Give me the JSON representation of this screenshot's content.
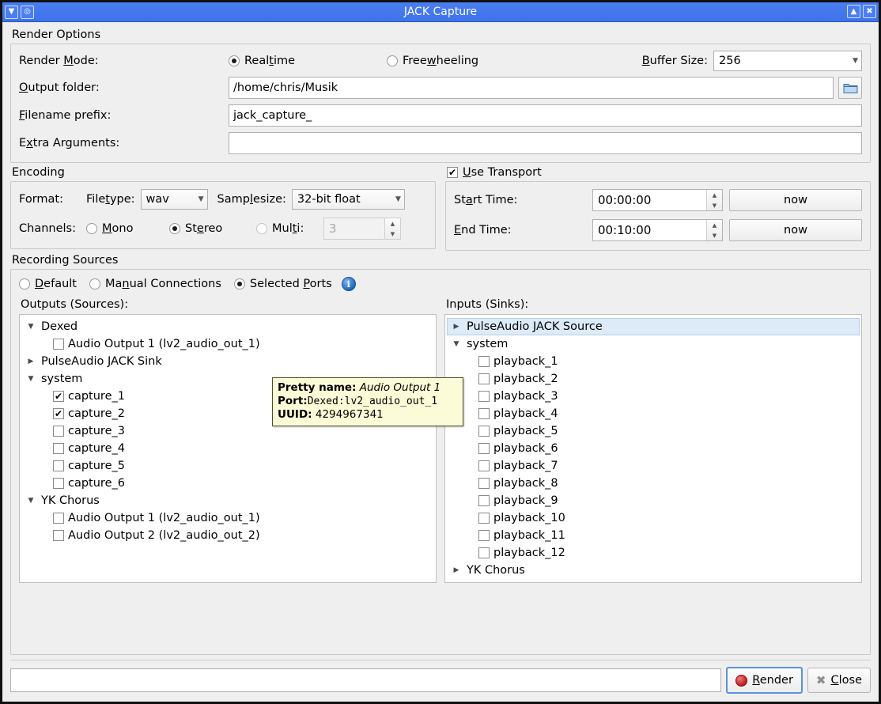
{
  "window": {
    "title": "JACK Capture",
    "titlebar_buttons_left": [
      "menu-chevron",
      "shade-circle"
    ],
    "titlebar_buttons_right": [
      "maximize-up",
      "close-x"
    ]
  },
  "render_options": {
    "group_title": "Render Options",
    "render_mode_label": "Render Mode:",
    "modes": [
      {
        "label": "Realtime",
        "mnemonic": "t",
        "selected": true
      },
      {
        "label": "Freewheeling",
        "mnemonic": "w",
        "selected": false
      }
    ],
    "buffer_size_label": "Buffer Size:",
    "buffer_size_value": "256",
    "output_folder_label": "Output folder:",
    "output_folder_value": "/home/chris/Musik",
    "browse_icon": "folder-icon",
    "filename_prefix_label": "Filename prefix:",
    "filename_prefix_value": "jack_capture_",
    "extra_arguments_label": "Extra Arguments:",
    "extra_arguments_value": ""
  },
  "encoding": {
    "group_title": "Encoding",
    "format_label": "Format:",
    "filetype_label": "Filetype:",
    "filetype_value": "wav",
    "samplesize_label": "Samplesize:",
    "samplesize_value": "32-bit float",
    "channels_label": "Channels:",
    "channels": [
      {
        "label": "Mono",
        "selected": false
      },
      {
        "label": "Stereo",
        "selected": true
      },
      {
        "label": "Multi:",
        "selected": false
      }
    ],
    "multi_value": "3",
    "multi_enabled": false
  },
  "transport": {
    "use_transport_label": "Use Transport",
    "use_transport_checked": true,
    "start_time_label": "Start Time:",
    "start_time_value": "00:00:00",
    "start_now_label": "now",
    "end_time_label": "End Time:",
    "end_time_value": "00:10:00",
    "end_now_label": "now"
  },
  "recording_sources": {
    "group_title": "Recording Sources",
    "modes": [
      {
        "label": "Default",
        "selected": false
      },
      {
        "label": "Manual Connections",
        "selected": false
      },
      {
        "label": "Selected Ports",
        "selected": true
      }
    ],
    "info_icon": "info-icon",
    "outputs_label": "Outputs (Sources):",
    "inputs_label": "Inputs (Sinks):",
    "outputs_tree": [
      {
        "type": "group",
        "label": "Dexed",
        "expanded": true
      },
      {
        "type": "port",
        "label": "Audio Output 1 (lv2_audio_out_1)",
        "checked": false
      },
      {
        "type": "group",
        "label": "PulseAudio JACK Sink",
        "expanded": false
      },
      {
        "type": "group",
        "label": "system",
        "expanded": true
      },
      {
        "type": "port",
        "label": "capture_1",
        "checked": true
      },
      {
        "type": "port",
        "label": "capture_2",
        "checked": true
      },
      {
        "type": "port",
        "label": "capture_3",
        "checked": false
      },
      {
        "type": "port",
        "label": "capture_4",
        "checked": false
      },
      {
        "type": "port",
        "label": "capture_5",
        "checked": false
      },
      {
        "type": "port",
        "label": "capture_6",
        "checked": false
      },
      {
        "type": "group",
        "label": "YK Chorus",
        "expanded": true
      },
      {
        "type": "port",
        "label": "Audio Output 1 (lv2_audio_out_1)",
        "checked": false
      },
      {
        "type": "port",
        "label": "Audio Output 2 (lv2_audio_out_2)",
        "checked": false
      }
    ],
    "inputs_tree": [
      {
        "type": "group",
        "label": "PulseAudio JACK Source",
        "expanded": false,
        "selected": true
      },
      {
        "type": "group",
        "label": "system",
        "expanded": true
      },
      {
        "type": "port",
        "label": "playback_1",
        "checked": false
      },
      {
        "type": "port",
        "label": "playback_2",
        "checked": false
      },
      {
        "type": "port",
        "label": "playback_3",
        "checked": false
      },
      {
        "type": "port",
        "label": "playback_4",
        "checked": false
      },
      {
        "type": "port",
        "label": "playback_5",
        "checked": false
      },
      {
        "type": "port",
        "label": "playback_6",
        "checked": false
      },
      {
        "type": "port",
        "label": "playback_7",
        "checked": false
      },
      {
        "type": "port",
        "label": "playback_8",
        "checked": false
      },
      {
        "type": "port",
        "label": "playback_9",
        "checked": false
      },
      {
        "type": "port",
        "label": "playback_10",
        "checked": false
      },
      {
        "type": "port",
        "label": "playback_11",
        "checked": false
      },
      {
        "type": "port",
        "label": "playback_12",
        "checked": false
      },
      {
        "type": "group",
        "label": "YK Chorus",
        "expanded": false
      }
    ]
  },
  "tooltip": {
    "pretty_name_key": "Pretty name:",
    "pretty_name_value": "Audio Output 1",
    "port_key": "Port:",
    "port_value": "Dexed:lv2_audio_out_1",
    "uuid_key": "UUID:",
    "uuid_value": "4294967341"
  },
  "bottom": {
    "status_value": "",
    "render_label": "Render",
    "render_icon": "record-dot-icon",
    "close_label": "Close",
    "close_icon": "x-icon"
  },
  "colors": {
    "titlebar": "#4a7ef0",
    "accent_focus": "#5b93d8",
    "selection": "#ddeaf7",
    "tooltip_bg": "#fbfbd7",
    "record_red": "#bb1414",
    "info_blue": "#1763b8"
  }
}
